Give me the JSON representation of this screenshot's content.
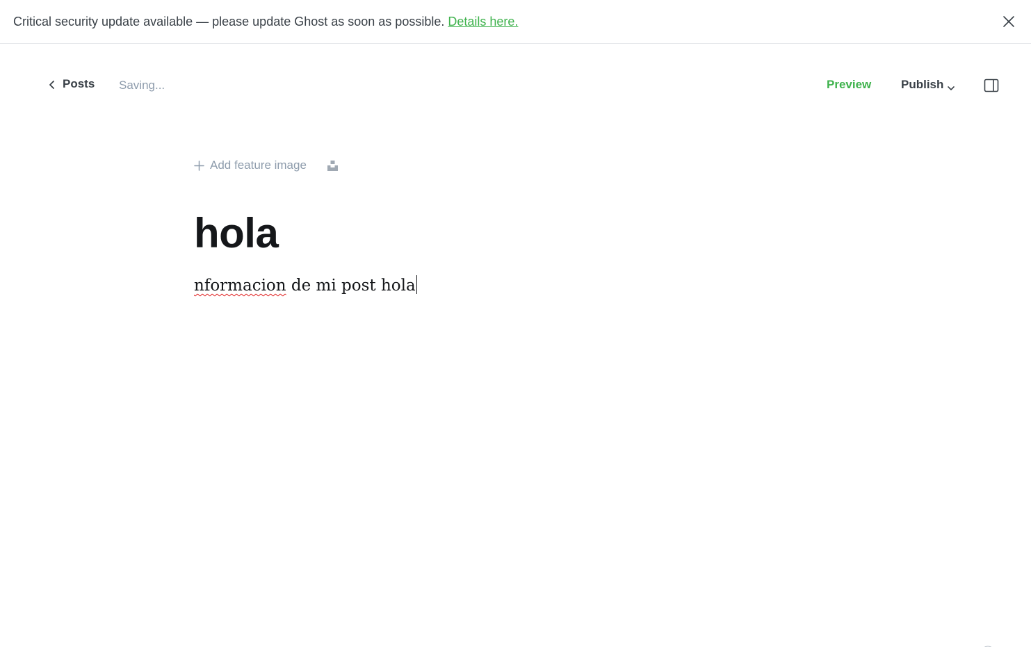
{
  "banner": {
    "message": "Critical security update available — please update Ghost as soon as possible.",
    "link_text": "Details here.",
    "close_icon": "close-icon",
    "link_color": "#3eb24c"
  },
  "header": {
    "back_label": "Posts",
    "status": "Saving...",
    "preview_label": "Preview",
    "publish_label": "Publish",
    "accent_color": "#3eb24c"
  },
  "editor": {
    "add_feature_label": "Add feature image",
    "title": "hola",
    "body_misspelled": "nformacion",
    "body_rest": " de mi post hola"
  }
}
